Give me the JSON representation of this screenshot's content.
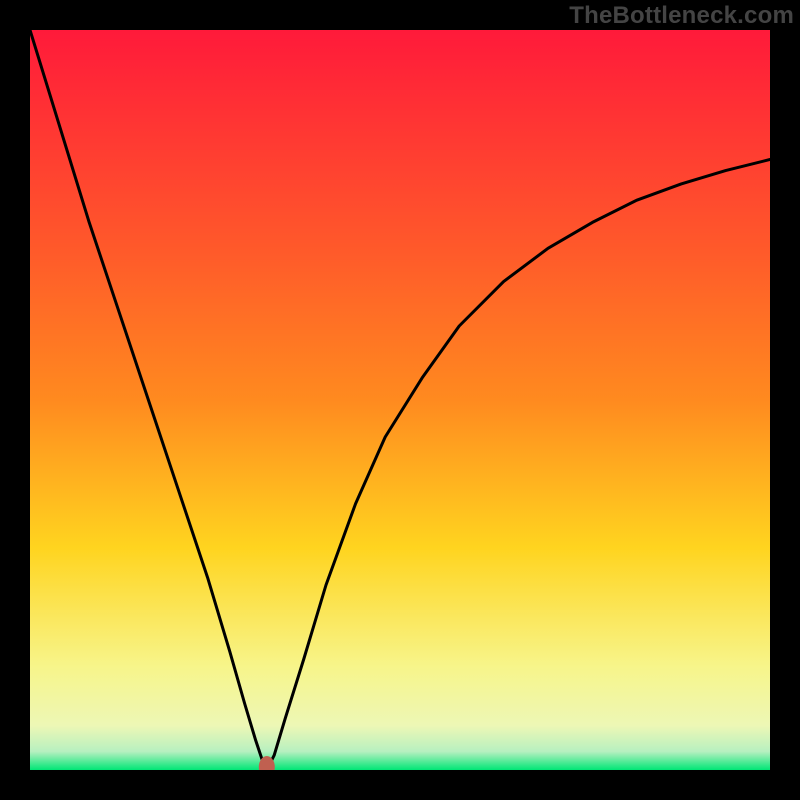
{
  "watermark": "TheBottleneck.com",
  "colors": {
    "frame": "#000000",
    "curve_stroke": "#000000",
    "marker_fill": "#c06050",
    "grad_top": "#ff1a3a",
    "grad_mid_upper": "#ff8a1f",
    "grad_mid": "#ffd41f",
    "grad_mid_lower": "#f7f58a",
    "grad_near_bottom": "#edf7b5",
    "grad_bottom": "#00e676"
  },
  "chart_data": {
    "type": "line",
    "title": "",
    "xlabel": "",
    "ylabel": "",
    "xlim": [
      0,
      100
    ],
    "ylim": [
      0,
      100
    ],
    "marker": {
      "x": 32,
      "y": 0
    },
    "series": [
      {
        "name": "curve",
        "x": [
          0,
          4,
          8,
          12,
          16,
          20,
          24,
          27,
          29,
          30.5,
          31.5,
          32,
          33,
          34.5,
          37,
          40,
          44,
          48,
          53,
          58,
          64,
          70,
          76,
          82,
          88,
          94,
          100
        ],
        "values": [
          100,
          87,
          74,
          62,
          50,
          38,
          26,
          16,
          9,
          4,
          1,
          0,
          2,
          7,
          15,
          25,
          36,
          45,
          53,
          60,
          66,
          70.5,
          74,
          77,
          79.2,
          81,
          82.5
        ]
      }
    ]
  }
}
